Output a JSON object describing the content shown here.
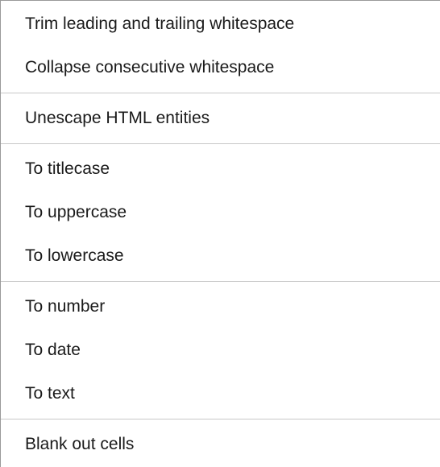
{
  "menu": {
    "groups": [
      {
        "items": [
          {
            "label": "Trim leading and trailing whitespace"
          },
          {
            "label": "Collapse consecutive whitespace"
          }
        ]
      },
      {
        "items": [
          {
            "label": "Unescape HTML entities"
          }
        ]
      },
      {
        "items": [
          {
            "label": "To titlecase"
          },
          {
            "label": "To uppercase"
          },
          {
            "label": "To lowercase"
          }
        ]
      },
      {
        "items": [
          {
            "label": "To number"
          },
          {
            "label": "To date"
          },
          {
            "label": "To text"
          }
        ]
      },
      {
        "items": [
          {
            "label": "Blank out cells"
          }
        ]
      }
    ]
  }
}
